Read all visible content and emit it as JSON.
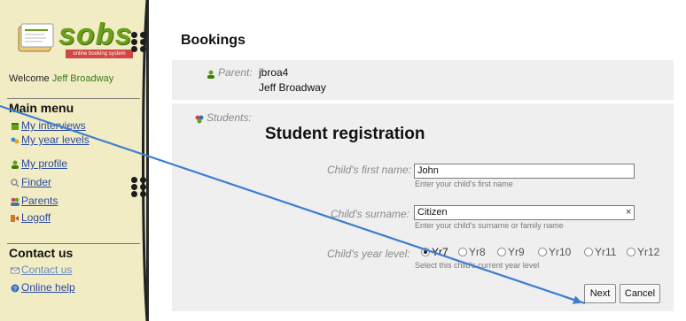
{
  "brand": {
    "name": "sobs",
    "tagline": "online booking system",
    "color": "#6aa019"
  },
  "sidebar": {
    "welcome_prefix": "Welcome",
    "welcome_user": "Jeff Broadway",
    "main_menu_title": "Main menu",
    "items": [
      {
        "label": "My interviews",
        "icon": "calendar-icon"
      },
      {
        "label": "My year levels",
        "icon": "group-icon"
      },
      {
        "label": "My profile",
        "icon": "person-icon"
      },
      {
        "label": "Finder",
        "icon": "finder-icon"
      },
      {
        "label": "Parents",
        "icon": "parents-icon"
      },
      {
        "label": "Logoff",
        "icon": "logoff-icon"
      }
    ],
    "contact_title": "Contact us",
    "contact_items": [
      {
        "label": "Contact us",
        "icon": "mail-icon"
      },
      {
        "label": "Online help",
        "icon": "help-icon"
      }
    ]
  },
  "main": {
    "page_title": "Bookings",
    "parent_label": "Parent:",
    "parent_username": "jbroa4",
    "parent_name": "Jeff Broadway",
    "students_label": "Students:",
    "form_title": "Student registration",
    "first_name": {
      "label": "Child's first name:",
      "value": "John",
      "hint": "Enter your child's first name"
    },
    "surname": {
      "label": "Child's surname:",
      "value": "Citizen",
      "hint": "Enter your child's surname or family name"
    },
    "year_level": {
      "label": "Child's year level:",
      "hint": "Select this child's current year level",
      "options": [
        "Yr7",
        "Yr8",
        "Yr9",
        "Yr10",
        "Yr11",
        "Yr12"
      ],
      "selected": "Yr7"
    },
    "next_label": "Next",
    "cancel_label": "Cancel"
  },
  "annotation_color": "#3f7fd0"
}
